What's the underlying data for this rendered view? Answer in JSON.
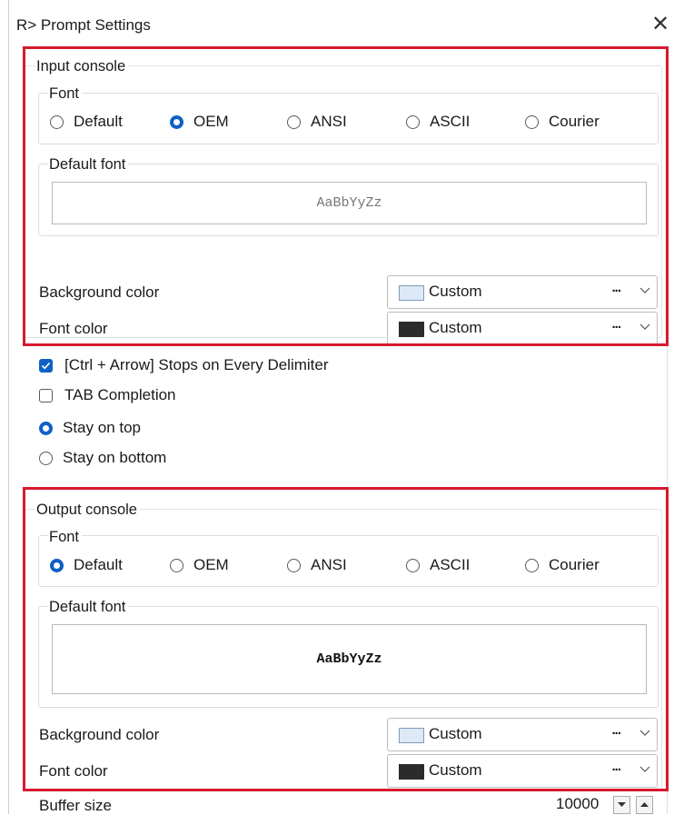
{
  "window": {
    "title": "R> Prompt Settings",
    "close_glyph": "✕"
  },
  "input_console": {
    "legend": "Input console",
    "font_group": {
      "legend": "Font",
      "options": [
        "Default",
        "OEM",
        "ANSI",
        "ASCII",
        "Courier"
      ],
      "selected": "OEM"
    },
    "default_font": {
      "legend": "Default font",
      "preview": "AaBbYyZz"
    },
    "background_color": {
      "label": "Background color",
      "value": "Custom",
      "swatch": "#dde9f7"
    },
    "font_color": {
      "label": "Font color",
      "value": "Custom",
      "swatch": "#2b2b2b"
    }
  },
  "options": {
    "ctrl_arrow": {
      "label": "[Ctrl + Arrow] Stops on Every Delimiter",
      "checked": true
    },
    "tab_completion": {
      "label": "TAB Completion",
      "checked": false
    },
    "stay_on_top": {
      "label": "Stay on top",
      "selected": true
    },
    "stay_on_bottom": {
      "label": "Stay on bottom",
      "selected": false
    }
  },
  "output_console": {
    "legend": "Output console",
    "font_group": {
      "legend": "Font",
      "options": [
        "Default",
        "OEM",
        "ANSI",
        "ASCII",
        "Courier"
      ],
      "selected": "Default"
    },
    "default_font": {
      "legend": "Default font",
      "preview": "AaBbYyZz"
    },
    "background_color": {
      "label": "Background color",
      "value": "Custom",
      "swatch": "#dde9f7"
    },
    "font_color": {
      "label": "Font color",
      "value": "Custom",
      "swatch": "#2b2b2b"
    }
  },
  "buffer": {
    "label": "Buffer size",
    "value": "10000"
  },
  "combo_dots": "...",
  "colors": {
    "accent": "#0f60c6",
    "highlight": "#d7192e"
  }
}
